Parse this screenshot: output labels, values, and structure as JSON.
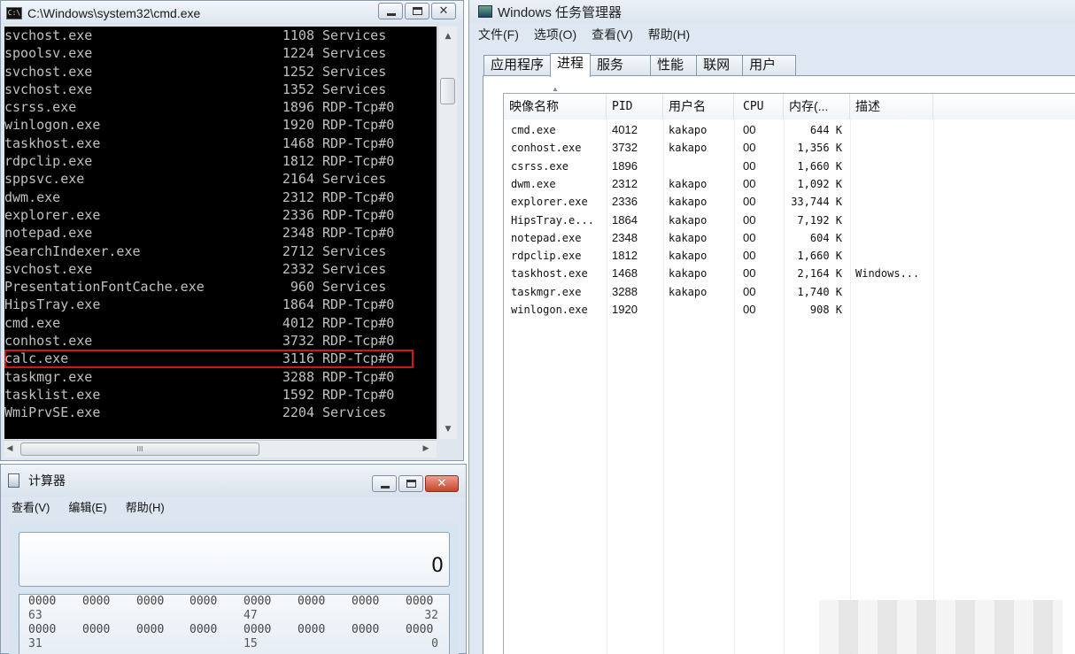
{
  "cmd": {
    "title": "C:\\Windows\\system32\\cmd.exe",
    "icon_label": "C:\\",
    "rows": [
      {
        "name": "svchost.exe",
        "pid": "1108",
        "session": "Services"
      },
      {
        "name": "spoolsv.exe",
        "pid": "1224",
        "session": "Services"
      },
      {
        "name": "svchost.exe",
        "pid": "1252",
        "session": "Services"
      },
      {
        "name": "svchost.exe",
        "pid": "1352",
        "session": "Services"
      },
      {
        "name": "csrss.exe",
        "pid": "1896",
        "session": "RDP-Tcp#0"
      },
      {
        "name": "winlogon.exe",
        "pid": "1920",
        "session": "RDP-Tcp#0"
      },
      {
        "name": "taskhost.exe",
        "pid": "1468",
        "session": "RDP-Tcp#0"
      },
      {
        "name": "rdpclip.exe",
        "pid": "1812",
        "session": "RDP-Tcp#0"
      },
      {
        "name": "sppsvc.exe",
        "pid": "2164",
        "session": "Services"
      },
      {
        "name": "dwm.exe",
        "pid": "2312",
        "session": "RDP-Tcp#0"
      },
      {
        "name": "explorer.exe",
        "pid": "2336",
        "session": "RDP-Tcp#0"
      },
      {
        "name": "notepad.exe",
        "pid": "2348",
        "session": "RDP-Tcp#0"
      },
      {
        "name": "SearchIndexer.exe",
        "pid": "2712",
        "session": "Services"
      },
      {
        "name": "svchost.exe",
        "pid": "2332",
        "session": "Services"
      },
      {
        "name": "PresentationFontCache.exe",
        "pid": "960",
        "session": "Services"
      },
      {
        "name": "HipsTray.exe",
        "pid": "1864",
        "session": "RDP-Tcp#0"
      },
      {
        "name": "cmd.exe",
        "pid": "4012",
        "session": "RDP-Tcp#0"
      },
      {
        "name": "conhost.exe",
        "pid": "3732",
        "session": "RDP-Tcp#0"
      },
      {
        "name": "calc.exe",
        "pid": "3116",
        "session": "RDP-Tcp#0",
        "highlighted": true
      },
      {
        "name": "taskmgr.exe",
        "pid": "3288",
        "session": "RDP-Tcp#0"
      },
      {
        "name": "tasklist.exe",
        "pid": "1592",
        "session": "RDP-Tcp#0"
      },
      {
        "name": "WmiPrvSE.exe",
        "pid": "2204",
        "session": "Services"
      }
    ],
    "hscroll_grip": "III"
  },
  "calc": {
    "title": "计算器",
    "menu": [
      "查看(V)",
      "编辑(E)",
      "帮助(H)"
    ],
    "display": "0",
    "binary_rows": [
      {
        "groups": [
          "0000",
          "0000",
          "0000",
          "0000",
          "0000",
          "0000",
          "0000",
          "0000"
        ],
        "marks": [
          "63",
          "47",
          "32"
        ]
      },
      {
        "groups": [
          "0000",
          "0000",
          "0000",
          "0000",
          "0000",
          "0000",
          "0000",
          "0000"
        ],
        "marks": [
          "31",
          "15",
          "0"
        ]
      }
    ]
  },
  "taskmgr": {
    "title": "Windows 任务管理器",
    "menu": [
      "文件(F)",
      "选项(O)",
      "查看(V)",
      "帮助(H)"
    ],
    "tabs": [
      "应用程序",
      "进程",
      "服务",
      "性能",
      "联网",
      "用户"
    ],
    "active_tab": "进程",
    "columns": [
      "映像名称",
      "PID",
      "用户名",
      "CPU",
      "内存(...",
      "描述"
    ],
    "processes": [
      {
        "name": "cmd.exe",
        "pid": "4012",
        "user": "kakapo",
        "cpu": "00",
        "mem": "644 K",
        "desc": ""
      },
      {
        "name": "conhost.exe",
        "pid": "3732",
        "user": "kakapo",
        "cpu": "00",
        "mem": "1,356 K",
        "desc": ""
      },
      {
        "name": "csrss.exe",
        "pid": "1896",
        "user": "",
        "cpu": "00",
        "mem": "1,660 K",
        "desc": ""
      },
      {
        "name": "dwm.exe",
        "pid": "2312",
        "user": "kakapo",
        "cpu": "00",
        "mem": "1,092 K",
        "desc": ""
      },
      {
        "name": "explorer.exe",
        "pid": "2336",
        "user": "kakapo",
        "cpu": "00",
        "mem": "33,744 K",
        "desc": ""
      },
      {
        "name": "HipsTray.e...",
        "pid": "1864",
        "user": "kakapo",
        "cpu": "00",
        "mem": "7,192 K",
        "desc": ""
      },
      {
        "name": "notepad.exe",
        "pid": "2348",
        "user": "kakapo",
        "cpu": "00",
        "mem": "604 K",
        "desc": ""
      },
      {
        "name": "rdpclip.exe",
        "pid": "1812",
        "user": "kakapo",
        "cpu": "00",
        "mem": "1,660 K",
        "desc": ""
      },
      {
        "name": "taskhost.exe",
        "pid": "1468",
        "user": "kakapo",
        "cpu": "00",
        "mem": "2,164 K",
        "desc": "Windows..."
      },
      {
        "name": "taskmgr.exe",
        "pid": "3288",
        "user": "kakapo",
        "cpu": "00",
        "mem": "1,740 K",
        "desc": ""
      },
      {
        "name": "winlogon.exe",
        "pid": "1920",
        "user": "",
        "cpu": "00",
        "mem": "908 K",
        "desc": ""
      }
    ]
  },
  "colors": {
    "console_bg": "#000000",
    "console_text": "#c0c0c0",
    "highlight_border": "#d01818",
    "window_chrome": "#dfe6ee"
  }
}
